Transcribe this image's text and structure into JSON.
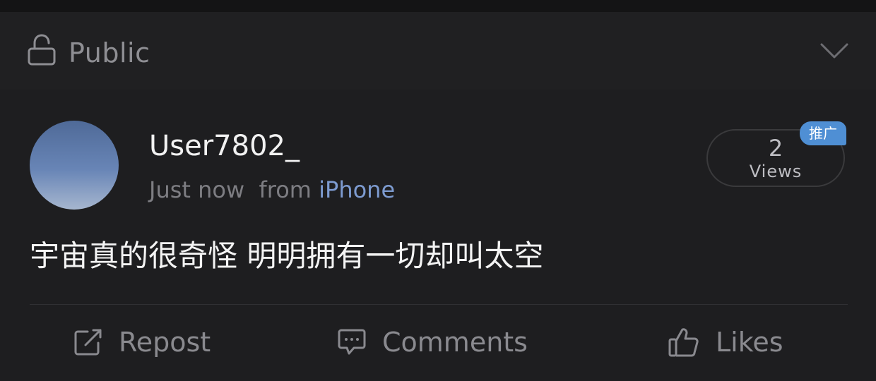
{
  "privacy_bar": {
    "label": "Public",
    "icon": "lock-open-icon",
    "expand_icon": "chevron-down-icon"
  },
  "post": {
    "author": {
      "name": "User7802_",
      "avatar": "avatar"
    },
    "time": "Just now",
    "from_prefix": "from",
    "device": "iPhone",
    "views": {
      "count": "2",
      "label": "Views"
    },
    "promo_badge": "推广",
    "text": "宇宙真的很奇怪 明明拥有一切却叫太空"
  },
  "actions": {
    "repost": {
      "label": "Repost",
      "icon": "repost-icon"
    },
    "comments": {
      "label": "Comments",
      "icon": "comment-icon"
    },
    "likes": {
      "label": "Likes",
      "icon": "thumbs-up-icon"
    }
  },
  "colors": {
    "background": "#1e1e20",
    "text_primary": "#f2f2f2",
    "text_secondary": "#8a8a8f",
    "link": "#7d9bd0",
    "badge": "#4f8fd4"
  }
}
